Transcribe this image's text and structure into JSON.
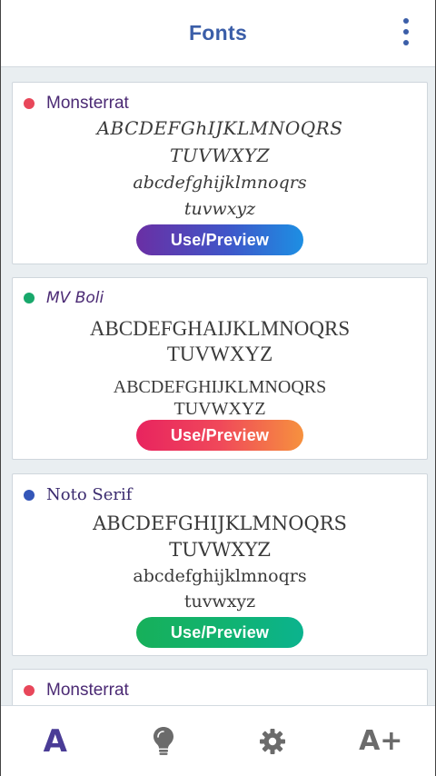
{
  "header": {
    "title": "Fonts",
    "menu_icon": "more-vert-icon",
    "accent_color": "#3b5ea8"
  },
  "cards": [
    {
      "name": "Monsterrat",
      "dot_color": "#e8475a",
      "upper_line1": "ABCDEFGhIJKLMNOQRS",
      "upper_line2": "TUVWXYZ",
      "lower_line1": "abcdefghijklmnoqrs",
      "lower_line2": "tuvwxyz",
      "button_label": "Use/Preview"
    },
    {
      "name": "MV Boli",
      "dot_color": "#18a86b",
      "upper_line1": "ABCDEFGHAIJKLMNOQRS",
      "upper_line2": "TUVWXYZ",
      "lower_line1": "ABCDEFGHIJKLMNOQRS",
      "lower_line2": "TUVWXYZ",
      "button_label": "Use/Preview"
    },
    {
      "name": "Noto Serif",
      "dot_color": "#3456b8",
      "upper_line1": "ABCDEFGHIJKLMNOQRS",
      "upper_line2": "TUVWXYZ",
      "lower_line1": "abcdefghijklmnoqrs",
      "lower_line2": "tuvwxyz",
      "button_label": "Use/Preview"
    },
    {
      "name": "Monsterrat",
      "dot_color": "#e8475a"
    }
  ],
  "bottom_nav": {
    "fonts_tab": "A",
    "tips_icon": "lightbulb-icon",
    "settings_icon": "gear-icon",
    "size_tab": "A+"
  }
}
